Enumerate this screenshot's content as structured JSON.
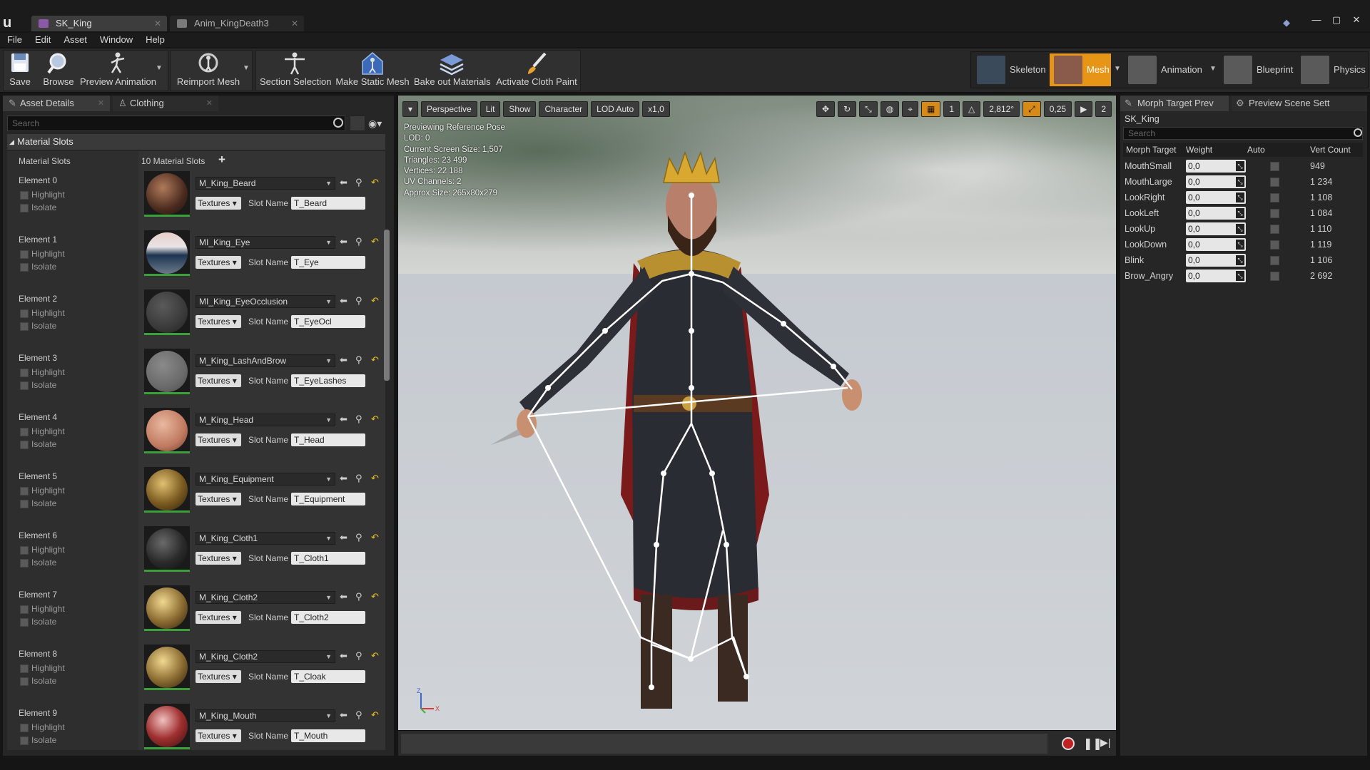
{
  "window": {
    "tabs": [
      {
        "label": "SK_King",
        "active": true
      },
      {
        "label": "Anim_KingDeath3",
        "active": false
      }
    ],
    "controls": [
      "—",
      "▢",
      "✕"
    ]
  },
  "menu": [
    "File",
    "Edit",
    "Asset",
    "Window",
    "Help"
  ],
  "toolbar": {
    "save": "Save",
    "browse": "Browse",
    "preview_animation": "Preview Animation",
    "reimport_mesh": "Reimport Mesh",
    "section_selection": "Section Selection",
    "make_static_mesh": "Make Static Mesh",
    "bake_out_materials": "Bake out Materials",
    "activate_cloth_paint": "Activate Cloth Paint"
  },
  "modes": {
    "skeleton": "Skeleton",
    "mesh": "Mesh",
    "animation": "Animation",
    "blueprint": "Blueprint",
    "physics": "Physics",
    "active": "Mesh"
  },
  "left_panel": {
    "tabs": [
      "Asset Details",
      "Clothing"
    ],
    "search_placeholder": "Search",
    "section_title": "Material Slots",
    "slots_label": "Material Slots",
    "slots_count": "10 Material Slots",
    "highlight_label": "Highlight",
    "isolate_label": "Isolate",
    "textures_label": "Textures",
    "slot_name_label": "Slot Name",
    "elements": [
      {
        "title": "Element 0",
        "material": "M_King_Beard",
        "slot": "T_Beard",
        "ball": "radial-gradient(circle at 40% 35%, #b07a5a, #4a2a1e 60%, #1e120c)"
      },
      {
        "title": "Element 1",
        "material": "MI_King_Eye",
        "slot": "T_Eye",
        "ball": "linear-gradient(#e8d0c8 0%, #e8e4e6 35%, #1e3450 55%, #6a7a8a 100%)"
      },
      {
        "title": "Element 2",
        "material": "MI_King_EyeOcclusion",
        "slot": "T_EyeOcl",
        "ball": "radial-gradient(circle at 40% 35%, #5a5a5a, #3a3a3a 60%, #222)"
      },
      {
        "title": "Element 3",
        "material": "M_King_LashAndBrow",
        "slot": "T_EyeLashes",
        "ball": "radial-gradient(circle at 40% 35%, #8a8a8a, #6a6a6a 60%, #4a4a4a)"
      },
      {
        "title": "Element 4",
        "material": "M_King_Head",
        "slot": "T_Head",
        "ball": "radial-gradient(circle at 40% 35%, #e8b8a0, #c07a60 60%, #6a3a2a)"
      },
      {
        "title": "Element 5",
        "material": "M_King_Equipment",
        "slot": "T_Equipment",
        "ball": "radial-gradient(circle at 40% 35%, #e0c070, #7a5a20 55%, #2a1e0c)"
      },
      {
        "title": "Element 6",
        "material": "M_King_Cloth1",
        "slot": "T_Cloth1",
        "ball": "radial-gradient(circle at 40% 35%, #6a6a6a, #2a2a2a 55%, #0e0e0e)"
      },
      {
        "title": "Element 7",
        "material": "M_King_Cloth2",
        "slot": "T_Cloth2",
        "ball": "radial-gradient(circle at 40% 35%, #f0d890, #8a6a30 55%, #2a1e0c)"
      },
      {
        "title": "Element 8",
        "material": "M_King_Cloth2",
        "slot": "T_Cloak",
        "ball": "radial-gradient(circle at 40% 35%, #f0d890, #8a6a30 55%, #2a1e0c)"
      },
      {
        "title": "Element 9",
        "material": "M_King_Mouth",
        "slot": "T_Mouth",
        "ball": "radial-gradient(circle at 40% 35%, #f0c0c0, #a03030 50%, #3a0c0c)"
      }
    ]
  },
  "viewport": {
    "buttons": [
      "Perspective",
      "Lit",
      "Show",
      "Character",
      "LOD Auto",
      "x1,0"
    ],
    "right_values": [
      "1",
      "2,812°",
      "0,25",
      "2"
    ],
    "info": [
      "Previewing Reference Pose",
      "LOD: 0",
      "Current Screen Size: 1,507",
      "Triangles: 23 499",
      "Vertices: 22 188",
      "UV Channels: 2",
      "Approx Size: 265x80x279"
    ],
    "axis_z": "Z",
    "axis_x": "X"
  },
  "right_panel": {
    "tabs": [
      "Morph Target Prev",
      "Preview Scene Sett"
    ],
    "asset": "SK_King",
    "search_placeholder": "Search",
    "headers": [
      "Morph Target",
      "Weight",
      "Auto",
      "Vert Count"
    ],
    "morphs": [
      {
        "name": "MouthSmall",
        "weight": "0,0",
        "count": "949"
      },
      {
        "name": "MouthLarge",
        "weight": "0,0",
        "count": "1 234"
      },
      {
        "name": "LookRight",
        "weight": "0,0",
        "count": "1 108"
      },
      {
        "name": "LookLeft",
        "weight": "0,0",
        "count": "1 084"
      },
      {
        "name": "LookUp",
        "weight": "0,0",
        "count": "1 110"
      },
      {
        "name": "LookDown",
        "weight": "0,0",
        "count": "1 119"
      },
      {
        "name": "Blink",
        "weight": "0,0",
        "count": "1 106"
      },
      {
        "name": "Brow_Angry",
        "weight": "0,0",
        "count": "2 692"
      }
    ]
  },
  "colors": {
    "accent_orange": "#e69516",
    "panel_bg": "#262626",
    "record_red": "#c02222"
  }
}
